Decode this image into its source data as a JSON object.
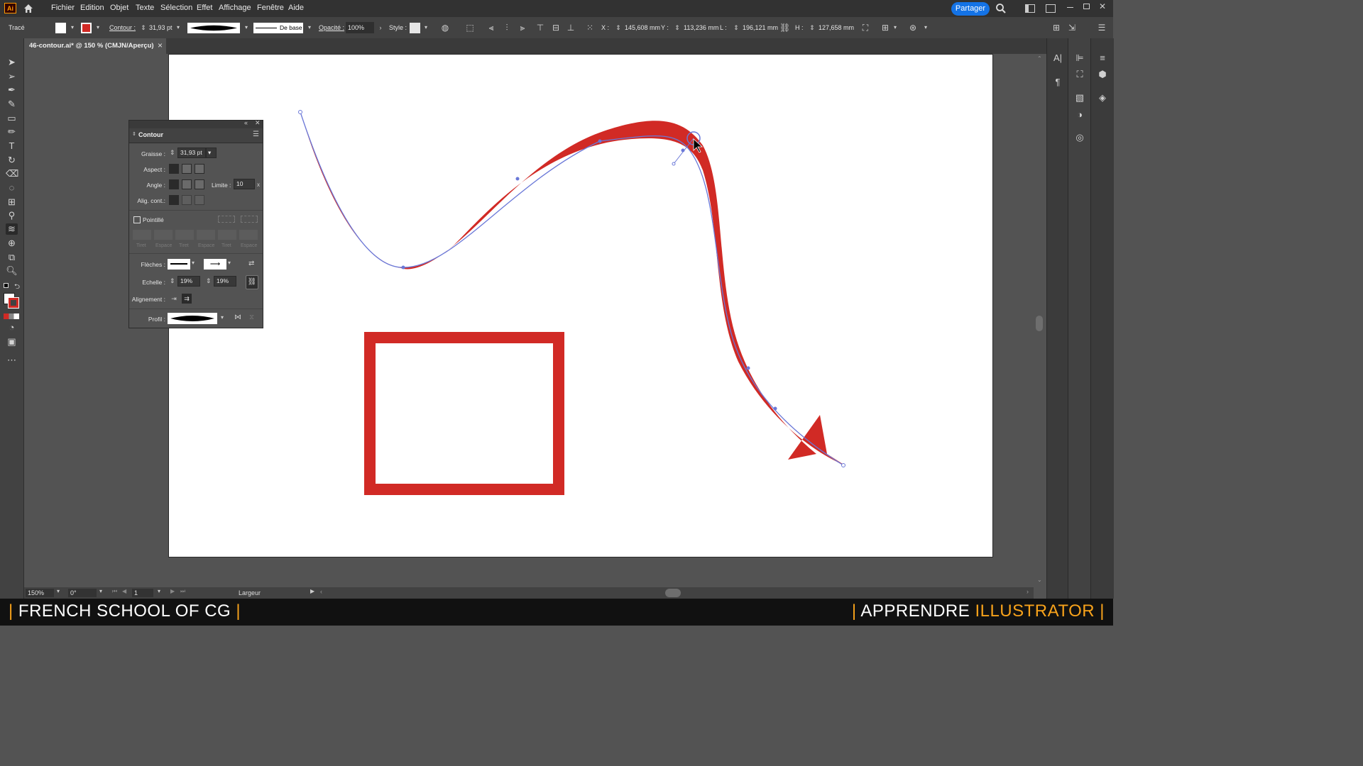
{
  "app": {
    "icon_label": "Ai"
  },
  "menu": [
    "Fichier",
    "Edition",
    "Objet",
    "Texte",
    "Sélection",
    "Effet",
    "Affichage",
    "Fenêtre",
    "Aide"
  ],
  "share_label": "Partager",
  "control": {
    "object_type": "Tracé",
    "contour_label": "Contour :",
    "stroke_weight": "31,93 pt",
    "brush_label": "De base",
    "opacity_label": "Opacité :",
    "opacity_value": "100%",
    "style_label": "Style :",
    "x_label": "X :",
    "x_value": "145,608 mm",
    "y_label": "Y :",
    "y_value": "113,236 mm",
    "w_label": "L :",
    "w_value": "196,121 mm",
    "h_label": "H :",
    "h_value": "127,658 mm"
  },
  "document_tab": {
    "title": "46-contour.ai* @ 150 % (CMJN/Aperçu)",
    "close": "×"
  },
  "contour_panel": {
    "title": "Contour",
    "weight_label": "Graisse :",
    "weight_value": "31,93 pt",
    "cap_label": "Aspect :",
    "corner_label": "Angle :",
    "limit_label": "Limite :",
    "limit_value": "10",
    "limit_unit": "x",
    "align_label": "Alig. cont.:",
    "dashed_label": "Pointillé",
    "dash_labels": [
      "Tiret",
      "Espace",
      "Tiret",
      "Espace",
      "Tiret",
      "Espace"
    ],
    "arrows_label": "Flèches :",
    "scale_label": "Echelle :",
    "scale_start": "19%",
    "scale_end": "19%",
    "alignment_label": "Alignement :",
    "profile_label": "Profil :"
  },
  "status": {
    "zoom": "150%",
    "rotation": "0°",
    "artboard_number": "1",
    "tool_label": "Largeur"
  },
  "footer": {
    "left_bar": "|",
    "left_text": "FRENCH SCHOOL OF CG",
    "left_bar2": "|",
    "right_bar": "|",
    "right_text1": "APPRENDRE",
    "right_text2": "ILLUSTRATOR",
    "right_bar2": "|"
  },
  "colors": {
    "stroke_red": "#d12a25",
    "path_blue": "#6a78d8",
    "share_blue": "#1473e6",
    "accent_orange": "#f7a21b"
  }
}
